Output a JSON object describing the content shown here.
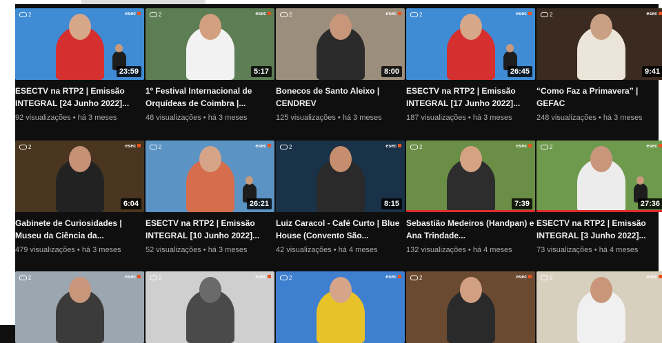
{
  "channel_logo": "esec",
  "cc_badge": "2",
  "videos": [
    {
      "title": "ESECTV na RTP2 | Emissão INTEGRAL [24 Junho 2022]...",
      "duration": "23:59",
      "views": "92 visualizações",
      "age": "há 3 meses",
      "bg": "#3f8cd4",
      "fig": "#d62f2f",
      "head": "#d7a78a"
    },
    {
      "title": "1º Festival Internacional de Orquídeas de Coimbra |...",
      "duration": "5:17",
      "views": "48 visualizações",
      "age": "há 3 meses",
      "bg": "#5d7d54",
      "fig": "#f2f2f2",
      "head": "#d3a07f"
    },
    {
      "title": "Bonecos de Santo Aleixo | CENDREV",
      "duration": "8:00",
      "views": "125 visualizações",
      "age": "há 3 meses",
      "bg": "#9c8e7c",
      "fig": "#2b2b2b",
      "head": "#c8967a"
    },
    {
      "title": "ESECTV na RTP2 | Emissão INTEGRAL [17 Junho 2022]...",
      "duration": "26:45",
      "views": "187 visualizações",
      "age": "há 3 meses",
      "bg": "#3f8cd4",
      "fig": "#d62f2f",
      "head": "#d7a78a"
    },
    {
      "title": "“Como Faz a Primavera” | GEFAC",
      "duration": "9:41",
      "views": "248 visualizações",
      "age": "há 3 meses",
      "bg": "#3b2a1f",
      "fig": "#ece6da",
      "head": "#caa085"
    },
    {
      "title": "Gabinete de Curiosidades | Museu da Ciência da...",
      "duration": "6:04",
      "views": "479 visualizações",
      "age": "há 3 meses",
      "bg": "#4a3620",
      "fig": "#222222",
      "head": "#c79177"
    },
    {
      "title": "ESECTV na RTP2 | Emissão INTEGRAL [10 Junho 2022]...",
      "duration": "26:21",
      "views": "52 visualizações",
      "age": "há 3 meses",
      "bg": "#5b93c4",
      "fig": "#d66e4e",
      "head": "#d6a489"
    },
    {
      "title": "Luiz Caracol - Café Curto | Blue House (Convento São...",
      "duration": "8:15",
      "views": "42 visualizações",
      "age": "há 4 meses",
      "bg": "#1a3247",
      "fig": "#2a2a2a",
      "head": "#c68e6e"
    },
    {
      "title": "Sebastião Medeiros (Handpan) e Ana Trindade...",
      "duration": "7:39",
      "views": "132 visualizações",
      "age": "há 4 meses",
      "bg": "#6a8e46",
      "fig": "#2d2d2d",
      "head": "#d6a284"
    },
    {
      "title": "ESECTV na RTP2 | Emissão INTEGRAL [3 Junho 2022]...",
      "duration": "27:36",
      "views": "73 visualizações",
      "age": "há 4 meses",
      "bg": "#6e9a4e",
      "fig": "#ececec",
      "head": "#c9967b"
    },
    {
      "title": "",
      "duration": "",
      "views": "",
      "age": "",
      "bg": "#9aa6b0",
      "fig": "#3b3b3b",
      "head": "#c9967b"
    },
    {
      "title": "",
      "duration": "",
      "views": "",
      "age": "",
      "bg": "#cfcfcf",
      "fig": "#4a4a4a",
      "head": "#6a6a6a"
    },
    {
      "title": "",
      "duration": "",
      "views": "",
      "age": "",
      "bg": "#3f7fd0",
      "fig": "#e8c229",
      "head": "#d6a489"
    },
    {
      "title": "",
      "duration": "",
      "views": "",
      "age": "",
      "bg": "#6b4a32",
      "fig": "#2a2a2a",
      "head": "#d1a082"
    },
    {
      "title": "",
      "duration": "",
      "views": "",
      "age": "",
      "bg": "#d8d0bf",
      "fig": "#f0f0f0",
      "head": "#c9967b"
    }
  ]
}
